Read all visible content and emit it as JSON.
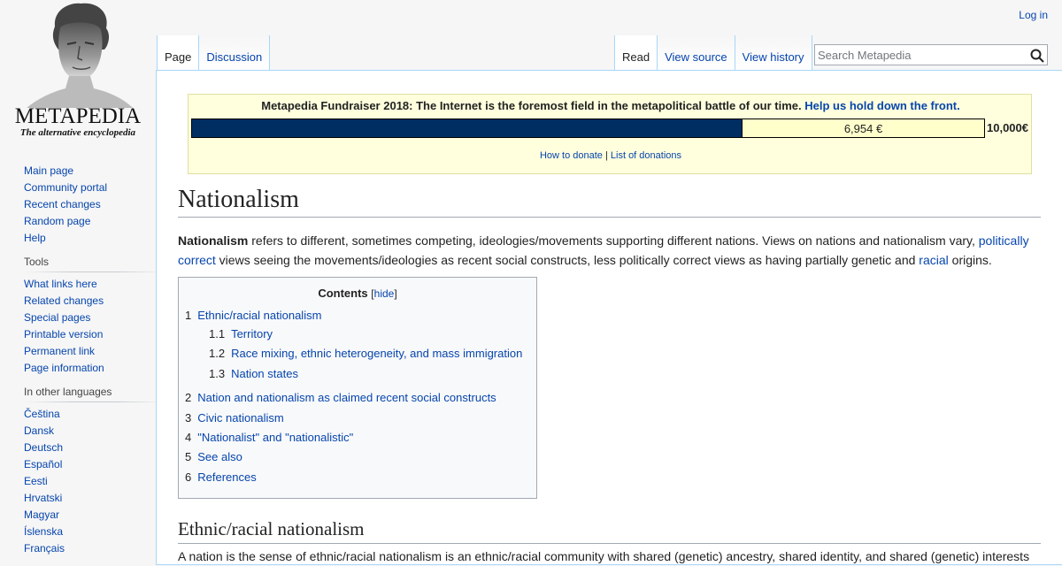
{
  "logo": {
    "wordmark": "METAPEDIA",
    "tagline": "The alternative encyclopedia"
  },
  "personal": {
    "login": "Log in"
  },
  "tabs": {
    "left": [
      "Page",
      "Discussion"
    ],
    "right": [
      "Read",
      "View source",
      "View history"
    ]
  },
  "search": {
    "placeholder": "Search Metapedia",
    "button_icon": "search-icon"
  },
  "sidebar": {
    "navigation": [
      "Main page",
      "Community portal",
      "Recent changes",
      "Random page",
      "Help"
    ],
    "tools_heading": "Tools",
    "tools": [
      "What links here",
      "Related changes",
      "Special pages",
      "Printable version",
      "Permanent link",
      "Page information"
    ],
    "languages_heading": "In other languages",
    "languages": [
      "Čeština",
      "Dansk",
      "Deutsch",
      "Español",
      "Eesti",
      "Hrvatski",
      "Magyar",
      "Íslenska",
      "Français"
    ]
  },
  "fundraiser": {
    "title": "Metapedia Fundraiser 2018: The Internet is the foremost field in the metapolitical battle of our time.",
    "cta": "Help us hold down the front.",
    "amount": "6,954 €",
    "goal": "10,000€",
    "progress": 0.6954,
    "link_donate": "How to donate",
    "link_sep": "|",
    "link_list": "List of donations",
    "fill_color": "#002e63"
  },
  "article": {
    "title": "Nationalism",
    "intro": {
      "bold": "Nationalism",
      "text1": " refers to different, sometimes competing, ideologies/movements supporting different nations. Views on nations and nationalism vary, ",
      "link1": "politically correct",
      "text2": " views seeing the movements/ideologies as recent social constructs, less politically correct views as having partially genetic and ",
      "link2": "racial",
      "text3": " origins."
    },
    "toc": {
      "title": "Contents",
      "toggle_open": "[",
      "toggle": "hide",
      "toggle_close": "]",
      "items": [
        {
          "num": "1",
          "label": "Ethnic/racial nationalism"
        },
        {
          "num": "1.1",
          "label": "Territory"
        },
        {
          "num": "1.2",
          "label": "Race mixing, ethnic heterogeneity, and mass immigration"
        },
        {
          "num": "1.3",
          "label": "Nation states"
        },
        {
          "num": "2",
          "label": "Nation and nationalism as claimed recent social constructs"
        },
        {
          "num": "3",
          "label": "Civic nationalism"
        },
        {
          "num": "4",
          "label": "\"Nationalist\" and \"nationalistic\""
        },
        {
          "num": "5",
          "label": "See also"
        },
        {
          "num": "6",
          "label": "References"
        }
      ]
    },
    "section_heading": "Ethnic/racial nationalism",
    "section_para": "A nation is the sense of ethnic/racial nationalism is an ethnic/racial community with shared (genetic) ancestry, shared identity, and shared (genetic) interests"
  }
}
